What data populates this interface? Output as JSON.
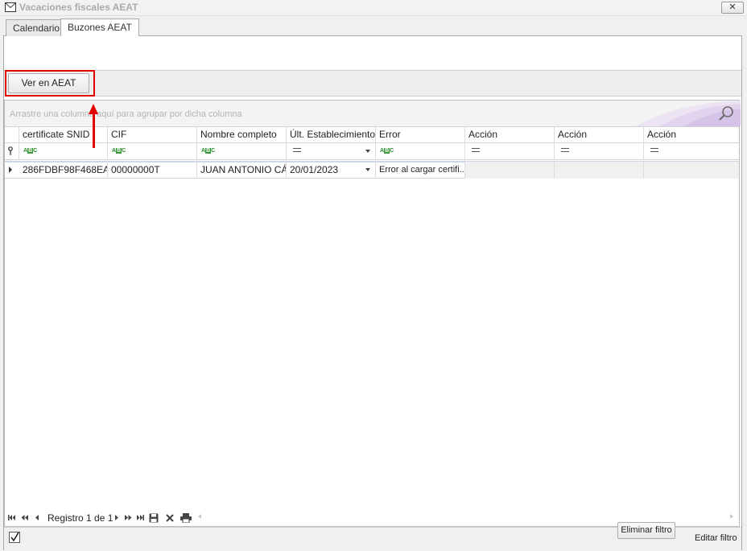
{
  "window": {
    "title": "Vacaciones fiscales AEAT",
    "close_label": "✕"
  },
  "tabs": [
    {
      "label": "Calendario"
    },
    {
      "label": "Buzones AEAT"
    }
  ],
  "toolbar": {
    "ver_label": "Ver en AEAT"
  },
  "grid": {
    "group_hint": "Arrastre una columna aquí para agrupar por dicha columna",
    "columns": [
      {
        "label": "certificate SNID"
      },
      {
        "label": "CIF"
      },
      {
        "label": "Nombre completo"
      },
      {
        "label": "Últ. Establecimiento"
      },
      {
        "label": "Error"
      },
      {
        "label": "Acción"
      },
      {
        "label": "Acción"
      },
      {
        "label": "Acción"
      }
    ],
    "rows": [
      {
        "certificate_snid": "286FDBF98F468EA...",
        "cif": "00000000T",
        "nombre": "JUAN ANTONIO CÁ...",
        "ult_establecimiento": "20/01/2023",
        "error": "Error al cargar certifi..."
      }
    ]
  },
  "navigator": {
    "record_text": "Registro 1 de 1"
  },
  "footer": {
    "eliminar_label": "Eliminar filtro",
    "editar_label": "Editar filtro"
  },
  "colors": {
    "highlight": "#e00000",
    "filter_badge": "#3a9a3a"
  }
}
